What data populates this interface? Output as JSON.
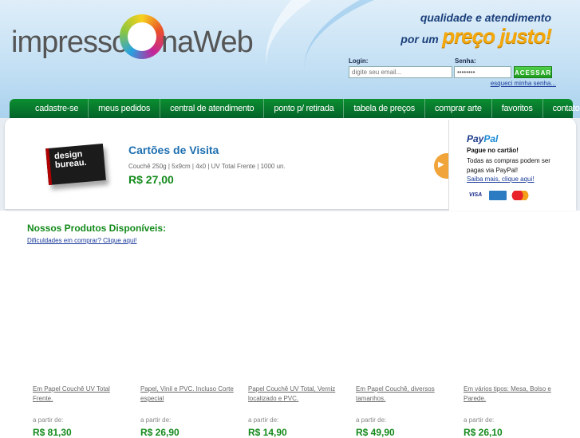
{
  "header": {
    "logo_left": "impresso",
    "logo_right": "naWeb",
    "slogan_line1": "qualidade e atendimento",
    "slogan_line2": "por um",
    "slogan_line3": "preço justo!"
  },
  "login": {
    "user_label": "Login:",
    "pass_label": "Senha:",
    "user_placeholder": "digite seu email...",
    "pass_value": "••••••••",
    "submit_label": "ACESSAR",
    "forgot_link": "esqueci minha senha..."
  },
  "nav": {
    "items": [
      "cadastre-se",
      "meus pedidos",
      "central de atendimento",
      "ponto p/ retirada",
      "tabela de preços",
      "comprar arte",
      "favoritos",
      "contato"
    ]
  },
  "featured": {
    "image_text": "design bureau.",
    "title": "Cartões de Visita",
    "description": "Couchê 250g | 5x9cm | 4x0 | UV Total Frente | 1000 un.",
    "price": "R$ 27,00"
  },
  "paypal": {
    "logo_a": "Pay",
    "logo_b": "Pal",
    "heading": "Pague no cartão!",
    "text": "Todas as compras podem ser pagas via PayPal!",
    "link": "Saiba mais, clique aqui!",
    "cards": [
      "VISA",
      "AMEX",
      "MC"
    ]
  },
  "products": {
    "title": "Nossos Produtos Disponíveis:",
    "help_link": "Dificuldades em comprar? Clique aqui!",
    "from_label": "a partir de:",
    "items": [
      {
        "desc": "Em Papel Couchê UV Total Frente.",
        "price": "R$ 81,30"
      },
      {
        "desc": "Papel, Vinil e PVC. Incluso Corte especial",
        "price": "R$ 26,90"
      },
      {
        "desc": "Papel Couchê UV Total, Verniz localizado e PVC.",
        "price": "R$ 14,90"
      },
      {
        "desc": "Em Papel Couchê, diversos tamanhos.",
        "price": "R$ 49,90"
      },
      {
        "desc": "Em vários tipos: Mesa, Bolso e Parede.",
        "price": "R$ 26,10"
      }
    ]
  }
}
